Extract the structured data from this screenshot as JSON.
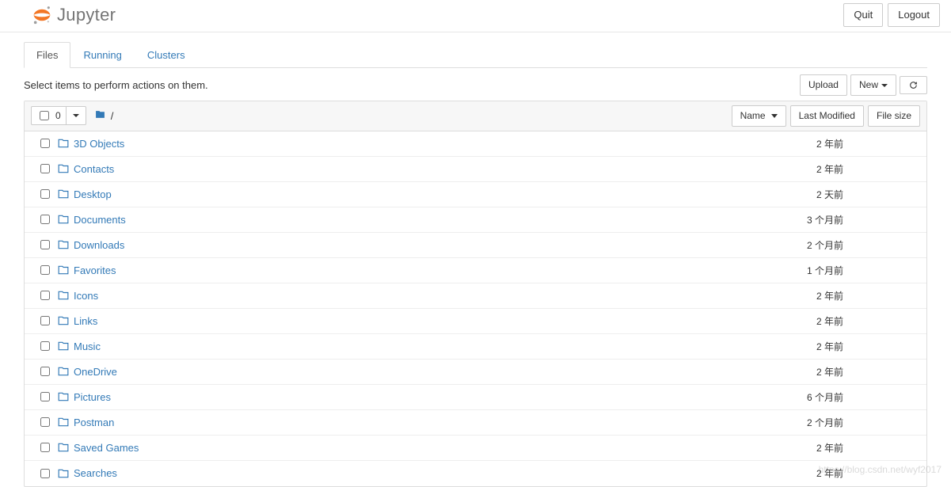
{
  "header": {
    "brand": "Jupyter",
    "quit_label": "Quit",
    "logout_label": "Logout"
  },
  "tabs": [
    {
      "label": "Files",
      "active": true
    },
    {
      "label": "Running",
      "active": false
    },
    {
      "label": "Clusters",
      "active": false
    }
  ],
  "actions": {
    "select_text": "Select items to perform actions on them.",
    "upload_label": "Upload",
    "new_label": "New",
    "refresh_title": "Refresh"
  },
  "list_header": {
    "selected_count": "0",
    "breadcrumb_root": "/",
    "name_col": "Name",
    "modified_col": "Last Modified",
    "size_col": "File size"
  },
  "items": [
    {
      "name": "3D Objects",
      "modified": "2 年前",
      "size": ""
    },
    {
      "name": "Contacts",
      "modified": "2 年前",
      "size": ""
    },
    {
      "name": "Desktop",
      "modified": "2 天前",
      "size": ""
    },
    {
      "name": "Documents",
      "modified": "3 个月前",
      "size": ""
    },
    {
      "name": "Downloads",
      "modified": "2 个月前",
      "size": ""
    },
    {
      "name": "Favorites",
      "modified": "1 个月前",
      "size": ""
    },
    {
      "name": "Icons",
      "modified": "2 年前",
      "size": ""
    },
    {
      "name": "Links",
      "modified": "2 年前",
      "size": ""
    },
    {
      "name": "Music",
      "modified": "2 年前",
      "size": ""
    },
    {
      "name": "OneDrive",
      "modified": "2 年前",
      "size": ""
    },
    {
      "name": "Pictures",
      "modified": "6 个月前",
      "size": ""
    },
    {
      "name": "Postman",
      "modified": "2 个月前",
      "size": ""
    },
    {
      "name": "Saved Games",
      "modified": "2 年前",
      "size": ""
    },
    {
      "name": "Searches",
      "modified": "2 年前",
      "size": ""
    }
  ],
  "watermark": "https://blog.csdn.net/wyf2017"
}
